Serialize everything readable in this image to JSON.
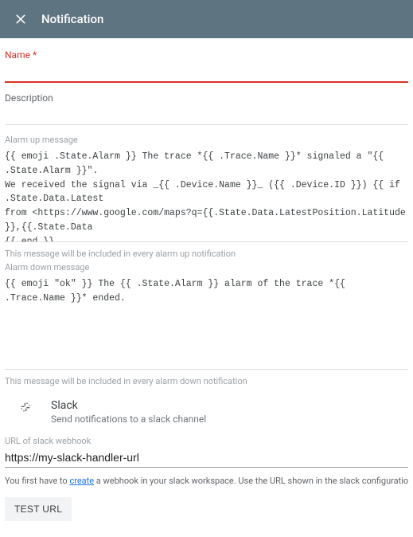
{
  "header": {
    "title": "Notification"
  },
  "fields": {
    "name": {
      "label": "Name",
      "value": ""
    },
    "description": {
      "label": "Description",
      "value": ""
    }
  },
  "alarm_up": {
    "label": "Alarm up message",
    "value": "{{ emoji .State.Alarm }} The trace *{{ .Trace.Name }}* signaled a \"{{ .State.Alarm }}\".\nWe received the signal via _{{ .Device.Name }}_ ({{ .Device.ID }}) {{ if .State.Data.Latest\nfrom <https://www.google.com/maps?q={{.State.Data.LatestPosition.Latitude }},{{.State.Data\n{{ end }}",
    "helper": "This message will be included in every alarm up notification"
  },
  "alarm_down": {
    "label": "Alarm down message",
    "value": "{{ emoji \"ok\" }} The {{ .State.Alarm }} alarm of the trace *{{ .Trace.Name }}* ended.",
    "helper": "This message will be included in every alarm down notification"
  },
  "slack": {
    "title": "Slack",
    "subtitle": "Send notifications to a slack channel",
    "url_label": "URL of slack webhook",
    "url_value": "https://my-slack-handler-url",
    "hint_prefix": "You first have to ",
    "hint_link": "create",
    "hint_suffix": " a webhook in your slack workspace. Use the URL shown in the slack configuration and enter this U",
    "test_label": "TEST URL"
  }
}
